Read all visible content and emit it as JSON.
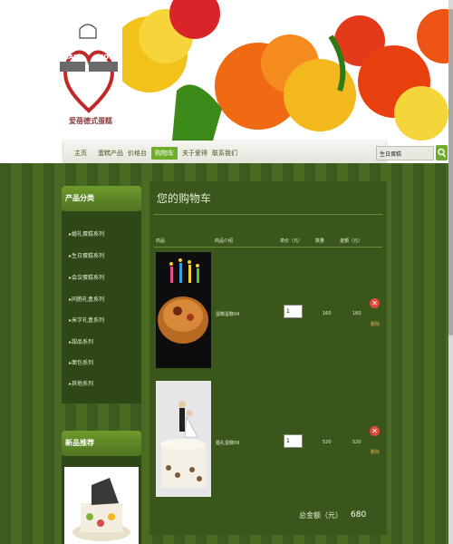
{
  "logo": {
    "text_top_left": "CAKE",
    "text_top_right": "AIDEI",
    "caption": "爱蓓德式蛋糕"
  },
  "nav": {
    "items": [
      {
        "label": "主页",
        "active": false
      },
      {
        "label": "蛋糕产品",
        "active": false
      },
      {
        "label": "价格台",
        "active": false
      },
      {
        "label": "购物车",
        "active": true
      },
      {
        "label": "关于爱得",
        "active": false
      },
      {
        "label": "联系我们",
        "active": false
      }
    ],
    "search_value": "生日蛋糕"
  },
  "sidebar": {
    "categories_title": "产品分类",
    "categories": [
      "婚礼蛋糕系列",
      "生日蛋糕系列",
      "会议蛋糕系列",
      "同胞礼盒系列",
      "米字礼盒系列",
      "甜品系列",
      "面包系列",
      "其他系列"
    ],
    "featured_title": "新品推荐"
  },
  "cart": {
    "title": "您的购物车",
    "columns": {
      "product": "商品",
      "intro": "商品介绍",
      "unit_price": "单价（元）",
      "quantity": "数量",
      "amount": "金额（元）"
    },
    "items": [
      {
        "name": "蛋糕蛋糕04",
        "quantity": "1",
        "unit_price": "160",
        "amount": "160",
        "delete_label": "删除"
      },
      {
        "name": "婚礼蛋糕09",
        "quantity": "1",
        "unit_price": "520",
        "amount": "520",
        "delete_label": "删除"
      }
    ],
    "total_label": "总金额（元）",
    "total_value": "680"
  },
  "colors": {
    "nav_active": "#6fae2a",
    "background": "#3f5a1e",
    "delete_icon": "#e04a3a"
  },
  "icons": [
    "heart-logo",
    "search-icon",
    "delete-icon"
  ]
}
